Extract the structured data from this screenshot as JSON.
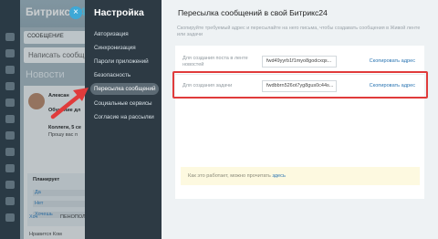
{
  "background": {
    "logo_text": "Битрикс",
    "logo_num": "24",
    "tab_label": "СООБЩЕНИЕ",
    "write_placeholder": "Написать сообщ",
    "news_heading": "Новости",
    "post_author": "Алексан",
    "post_line1": "Обучение дл",
    "post_line2": "Коллеги, 5 се",
    "post_line3": "Прошу вас п",
    "box_title": "Планирует",
    "box_opt1": "Да",
    "box_opt2": "Нет",
    "box_opt3": "Хочешь",
    "box_link": "Хоч",
    "footer_text": "Нравится   Ком",
    "extra_word": "ПЕНОПОЛ"
  },
  "close_icon": "×",
  "menu": {
    "title": "Настройка",
    "items": [
      {
        "label": "Авторизация"
      },
      {
        "label": "Синхронизация"
      },
      {
        "label": "Пароли приложений"
      },
      {
        "label": "Безопасность"
      },
      {
        "label": "Пересылка сообщений",
        "active": true
      },
      {
        "label": "Социальные сервисы"
      },
      {
        "label": "Согласие на рассылки"
      }
    ]
  },
  "content": {
    "title": "Пересылка сообщений в свой Битрикс24",
    "description": "Скопируйте требуемый адрес и пересылайте на него письма, чтобы создавать сообщения в Живой ленте или задачи",
    "rows": [
      {
        "label": "Для создания поста в ленте новостей",
        "address": "fwd49yyrb1f1myo8godcxqs...",
        "copy": "Скопировать адрес"
      },
      {
        "label": "Для создания задачи",
        "address": "fwdbbrn526ot7yg8gus0c44s...",
        "copy": "Скопировать адрес"
      }
    ],
    "info_text": "Как это работает, можно прочитать ",
    "info_link": "здесь"
  },
  "colors": {
    "menu_bg": "#2d3a44",
    "active_item": "#5c6a74",
    "highlight": "#e03b3b",
    "link": "#2c76b3",
    "close": "#3ea8d6"
  }
}
